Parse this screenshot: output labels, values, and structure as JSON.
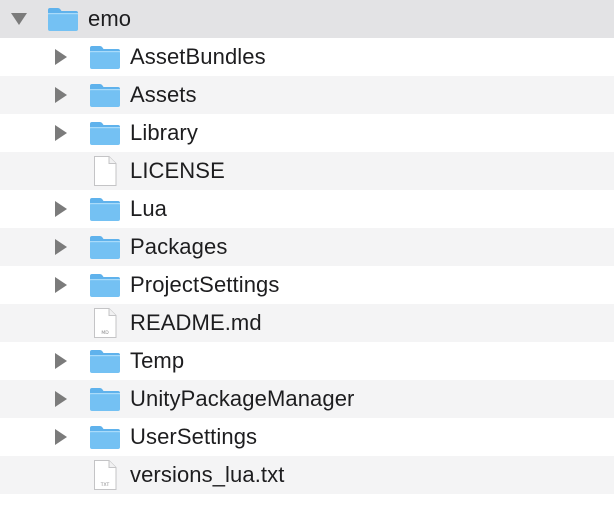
{
  "root": {
    "label": "emo",
    "icon": "folder-icon",
    "expanded": true
  },
  "items": [
    {
      "label": "AssetBundles",
      "icon": "folder-icon",
      "expandable": true
    },
    {
      "label": "Assets",
      "icon": "folder-icon",
      "expandable": true
    },
    {
      "label": "Library",
      "icon": "folder-icon",
      "expandable": true
    },
    {
      "label": "LICENSE",
      "icon": "document-icon",
      "expandable": false
    },
    {
      "label": "Lua",
      "icon": "folder-icon",
      "expandable": true
    },
    {
      "label": "Packages",
      "icon": "folder-icon",
      "expandable": true
    },
    {
      "label": "ProjectSettings",
      "icon": "folder-icon",
      "expandable": true
    },
    {
      "label": "README.md",
      "icon": "document-icon",
      "badge": "MD",
      "expandable": false
    },
    {
      "label": "Temp",
      "icon": "folder-icon",
      "expandable": true
    },
    {
      "label": "UnityPackageManager",
      "icon": "folder-icon",
      "expandable": true
    },
    {
      "label": "UserSettings",
      "icon": "folder-icon",
      "expandable": true
    },
    {
      "label": "versions_lua.txt",
      "icon": "document-icon",
      "badge": "TXT",
      "expandable": false
    }
  ],
  "colors": {
    "folder_body": "#74c1f3",
    "folder_tab": "#5fb2ec",
    "folder_edge": "#4aa4e4",
    "disclosure": "#7b7b7b",
    "stripe": "#f4f4f5",
    "root_row": "#e3e3e5"
  }
}
